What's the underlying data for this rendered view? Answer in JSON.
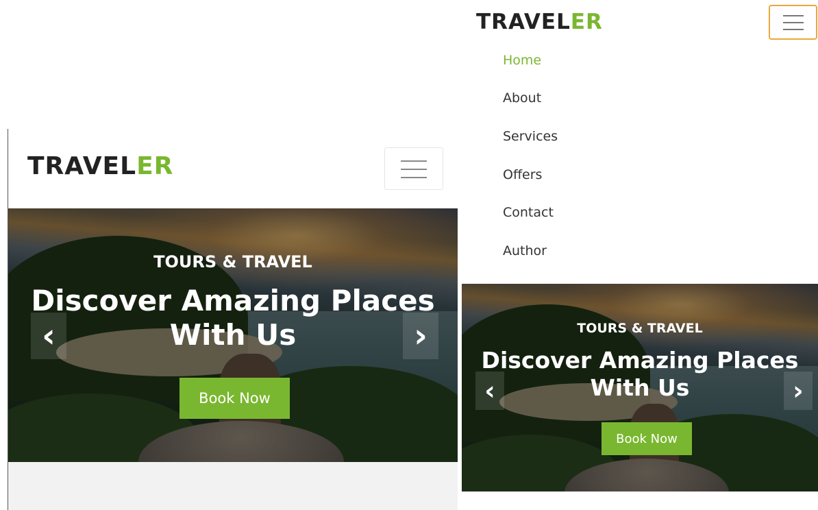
{
  "brand": {
    "main": "TRAVEL",
    "accent": "ER"
  },
  "nav": {
    "items": [
      "Home",
      "About",
      "Services",
      "Offers",
      "Contact",
      "Author"
    ],
    "active": "Home"
  },
  "hero": {
    "subtitle": "TOURS & TRAVEL",
    "title_line1": "Discover Amazing Places",
    "title_line2": "With Us",
    "button_label": "Book Now",
    "prev_icon": "‹",
    "next_icon": "›"
  },
  "colors": {
    "accent": "#7ab730",
    "toggler_focus": "#e8a93a",
    "text_dark": "#222222"
  },
  "icons": {
    "toggler": "hamburger-icon",
    "prev": "chevron-left-icon",
    "next": "chevron-right-icon"
  }
}
